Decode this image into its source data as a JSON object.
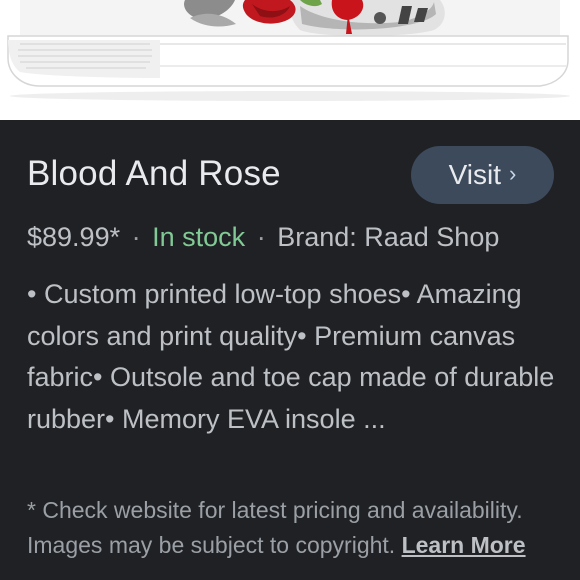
{
  "product": {
    "title": "Blood And Rose",
    "visit_label": "Visit",
    "visit_chevron": "›",
    "price": "$89.99*",
    "separator": "·",
    "stock": "In stock",
    "brand": "Brand: Raad Shop",
    "description": "• Custom printed low-top shoes• Amazing colors and print quality• Premium canvas fabric• Outsole and toe cap made of durable rubber• Memory EVA insole ...",
    "disclaimer": "* Check website for latest pricing and availability. Images may be subject to copyright.",
    "learn_more": "Learn More"
  },
  "colors": {
    "background": "#202124",
    "title": "#e8eaed",
    "body_text": "#bdc1c6",
    "stock": "#81c995",
    "button_bg": "#3c4a5c"
  },
  "icons": {
    "visit_chevron": "chevron-right-icon"
  }
}
